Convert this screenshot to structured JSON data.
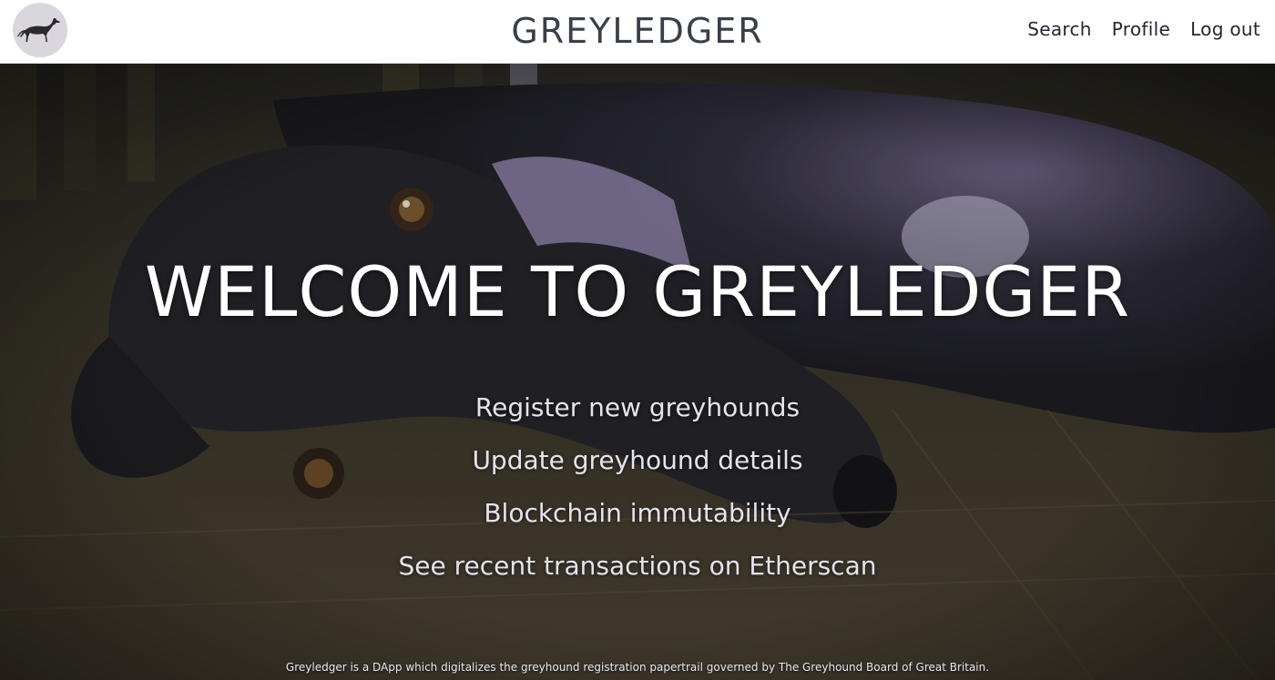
{
  "header": {
    "logo_icon": "greyhound-logo-icon",
    "brand": "GREYLEDGER",
    "nav": [
      {
        "label": "Search"
      },
      {
        "label": "Profile"
      },
      {
        "label": "Log out"
      }
    ]
  },
  "hero": {
    "background": "greyhound-photo",
    "title": "WELCOME TO GREYLEDGER",
    "features": [
      "Register new greyhounds",
      "Update greyhound details",
      "Blockchain immutability",
      "See recent transactions on Etherscan"
    ],
    "footer": "Greyledger is a DApp which digitalizes the greyhound registration papertrail governed by The Greyhound Board of Great Britain."
  },
  "colors": {
    "header_bg": "#ffffff",
    "brand_text": "#3a3f4a",
    "hero_text": "#ffffff",
    "feature_text": "#e6e3ee",
    "accent_lavender": "#a99bc4"
  }
}
